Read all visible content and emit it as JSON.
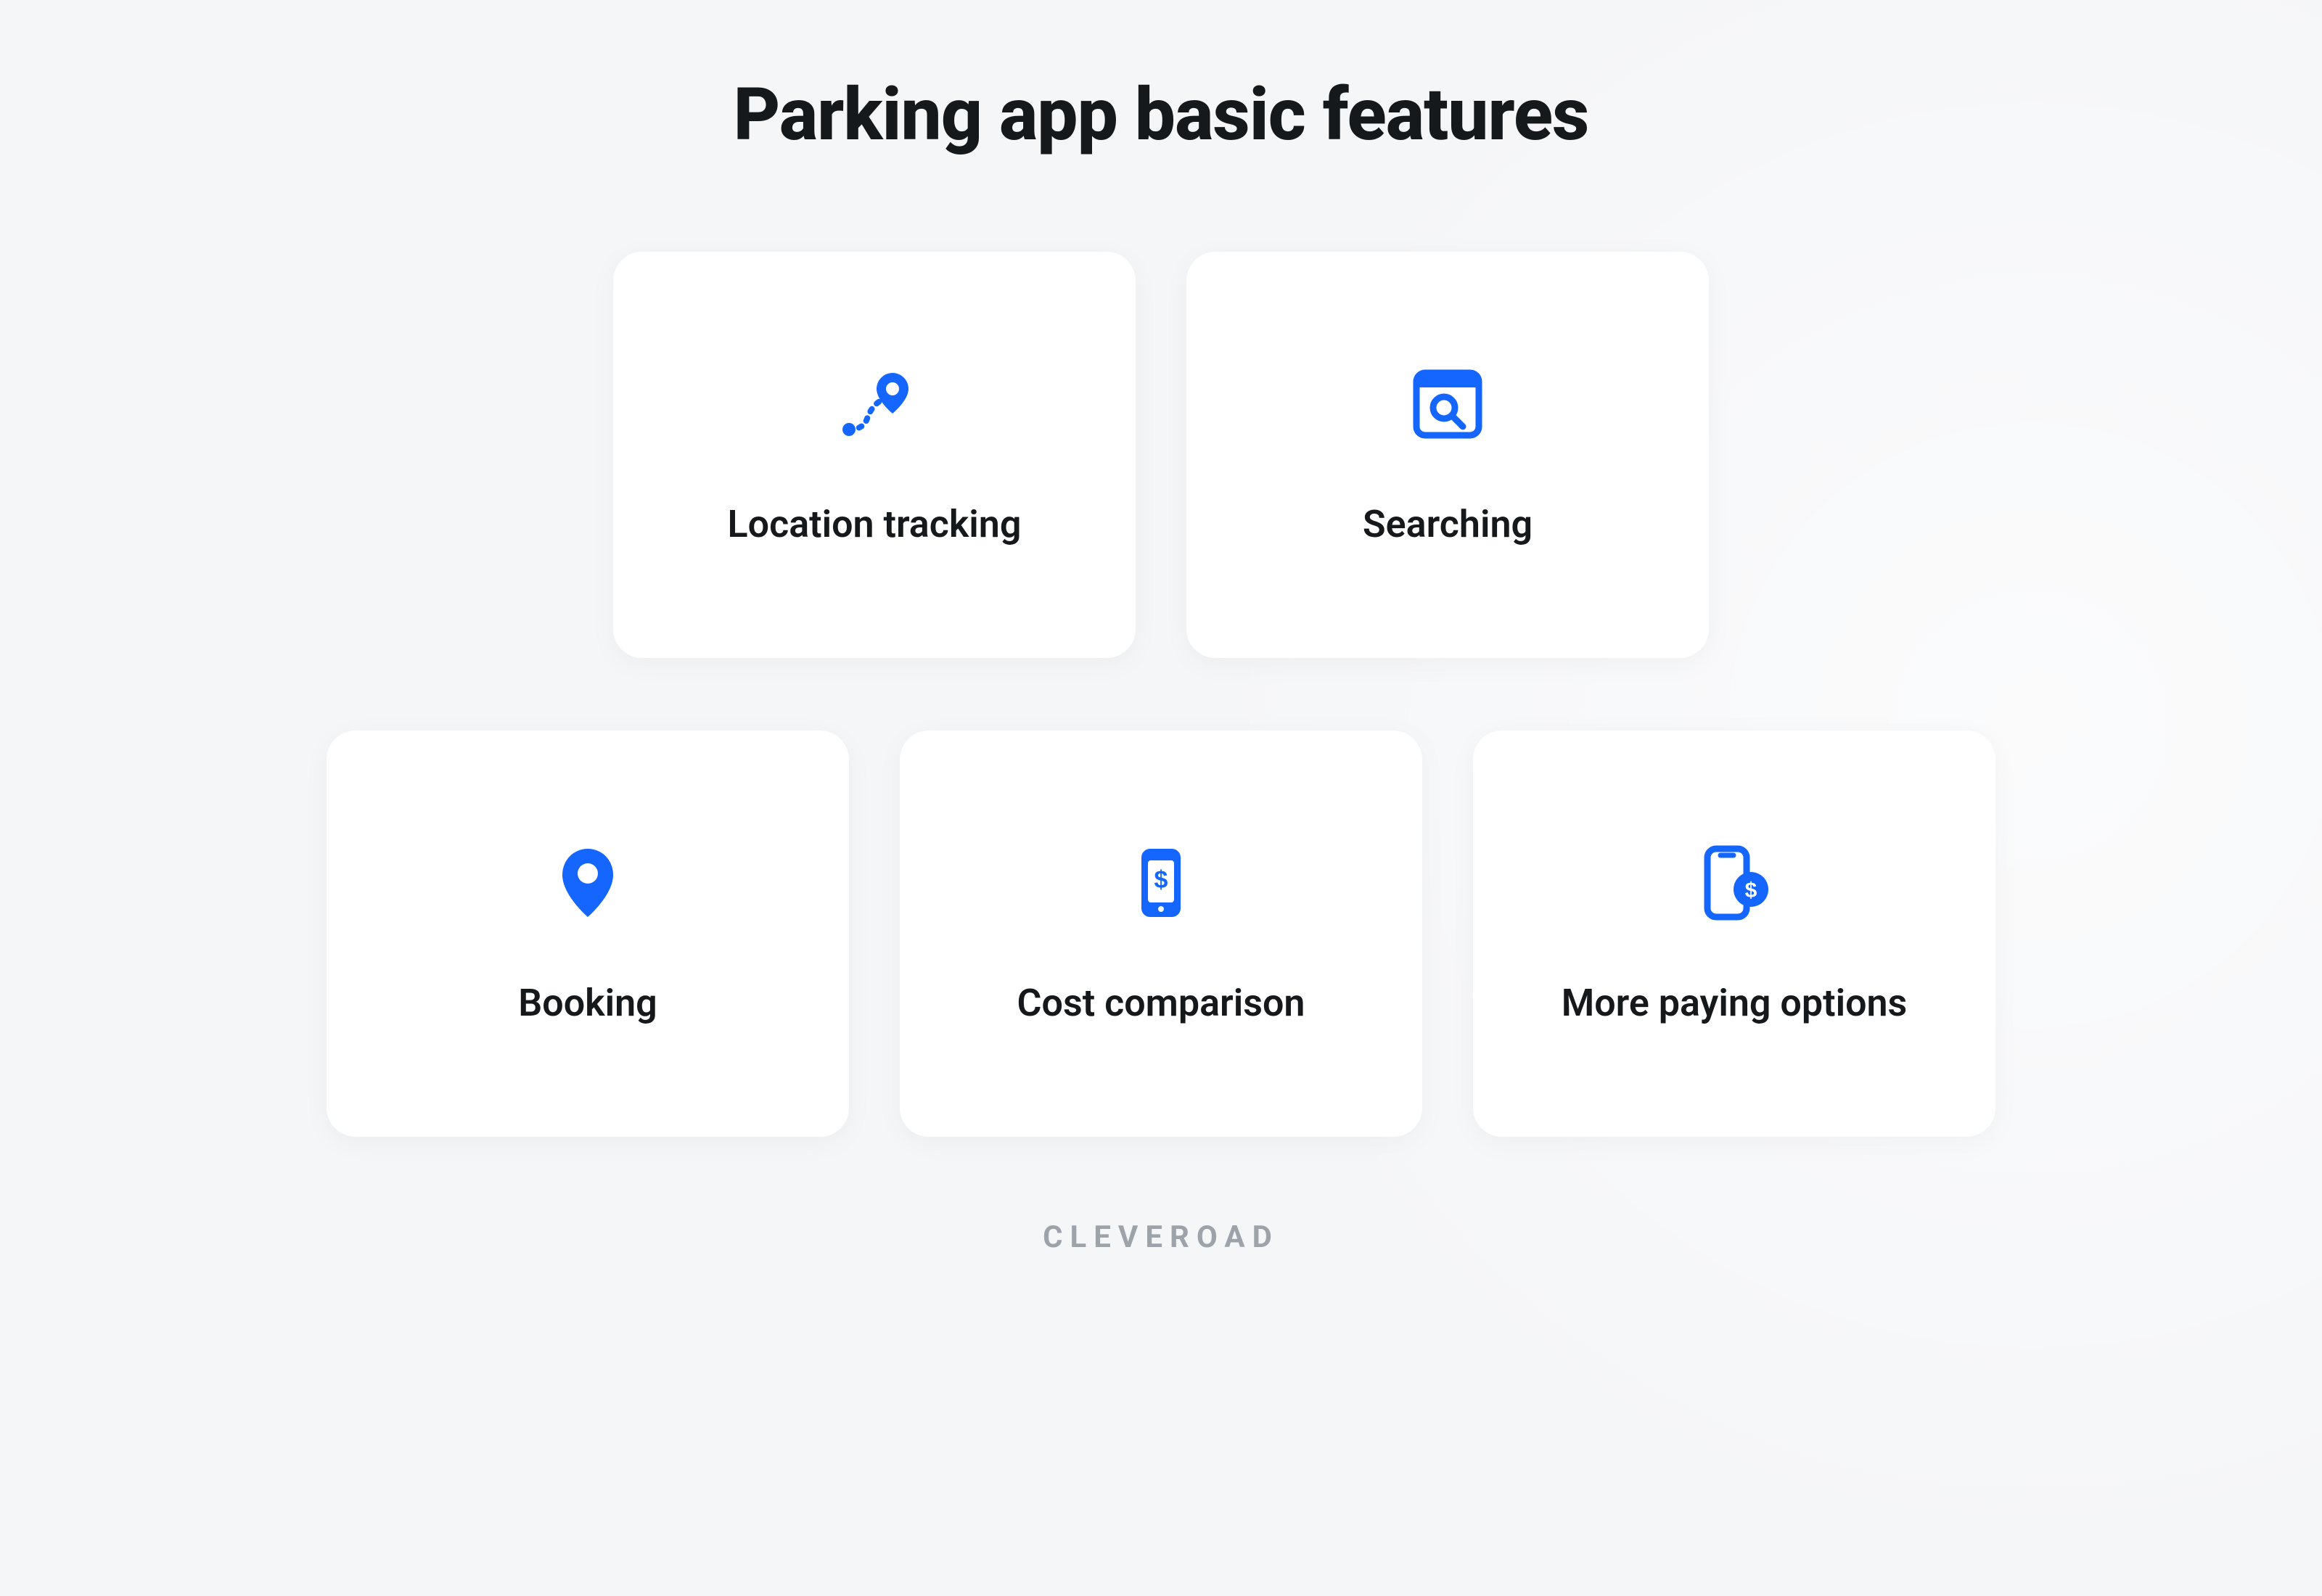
{
  "title": "Parking app basic features",
  "brand": "CLEVEROAD",
  "colors": {
    "accent": "#1565ff",
    "bg": "#f5f6f8",
    "text": "#16191c",
    "muted": "#9da3ab"
  },
  "rows": [
    {
      "cards": [
        {
          "label": "Location tracking",
          "icon": "location-route-icon"
        },
        {
          "label": "Searching",
          "icon": "search-window-icon"
        }
      ]
    },
    {
      "cards": [
        {
          "label": "Booking",
          "icon": "map-pin-icon"
        },
        {
          "label": "Cost comparison",
          "icon": "phone-dollar-icon"
        },
        {
          "label": "More paying options",
          "icon": "phone-coin-icon"
        }
      ]
    }
  ]
}
